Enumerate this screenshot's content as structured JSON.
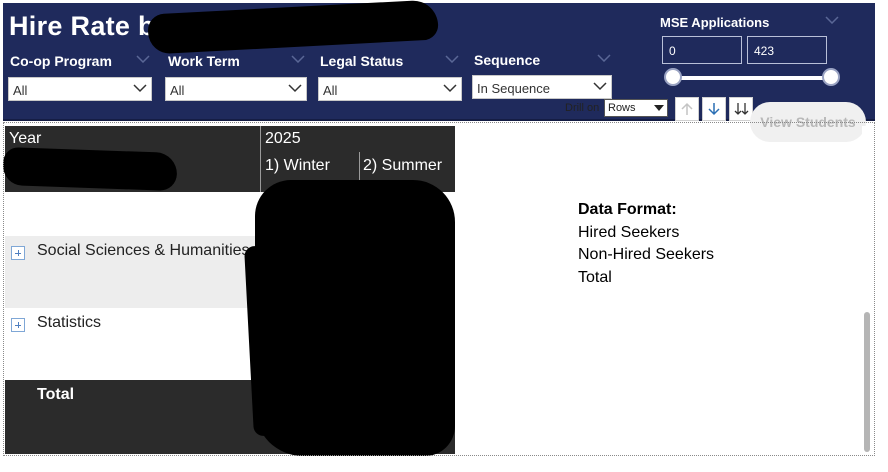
{
  "header": {
    "title": "Hire Rate by"
  },
  "filters": [
    {
      "label": "Co-op Program",
      "value": "All"
    },
    {
      "label": "Work Term",
      "value": "All"
    },
    {
      "label": "Legal Status",
      "value": "All"
    },
    {
      "label": "Sequence",
      "value": "In Sequence"
    }
  ],
  "mse": {
    "label": "MSE Applications",
    "min_value": "0",
    "max_value": "423"
  },
  "toolbar": {
    "drill_on_label": "Drill on",
    "drill_select_value": "Rows",
    "view_students_label": "View Students"
  },
  "matrix": {
    "header_row_label": "Year",
    "year": "2025",
    "columns": [
      "1) Winter",
      "2) Summer"
    ],
    "rows": [
      {
        "label": "Social Sciences & Humanities"
      },
      {
        "label": "Statistics"
      }
    ],
    "total_label": "Total"
  },
  "data_format": {
    "heading": "Data Format:",
    "lines": [
      "Hired Seekers",
      "Non-Hired Seekers",
      "Total"
    ]
  },
  "colors": {
    "header_bg": "#1f2a5c",
    "matrix_header_bg": "#2b2b2b",
    "band_bg": "#ededed"
  }
}
